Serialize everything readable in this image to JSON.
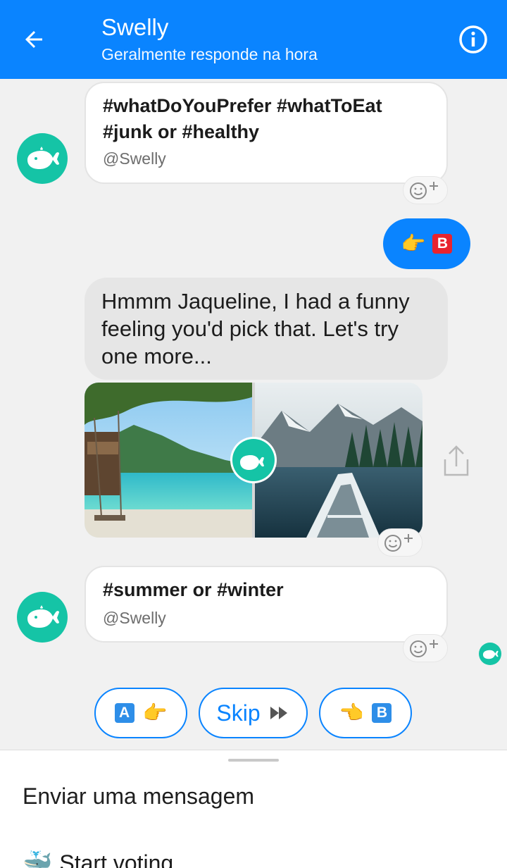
{
  "header": {
    "title": "Swelly",
    "subtitle": "Geralmente responde na hora"
  },
  "messages": {
    "card1": {
      "title": "#whatDoYouPrefer #whatToEat #junk or #healthy",
      "sub": "@Swelly"
    },
    "reply_keycap": "B",
    "bot_text": "Hmmm Jaqueline, I had a funny feeling you'd pick that. Let's try one more...",
    "card2": {
      "title": "#summer or #winter",
      "sub": "@Swelly"
    }
  },
  "quick_replies": {
    "a_key": "A",
    "skip": "Skip",
    "b_key": "B"
  },
  "composer": {
    "placeholder": "Enviar uma mensagem",
    "menu_item": "Start voting"
  },
  "colors": {
    "brand_blue": "#0a84ff",
    "teal": "#15c4a6"
  }
}
